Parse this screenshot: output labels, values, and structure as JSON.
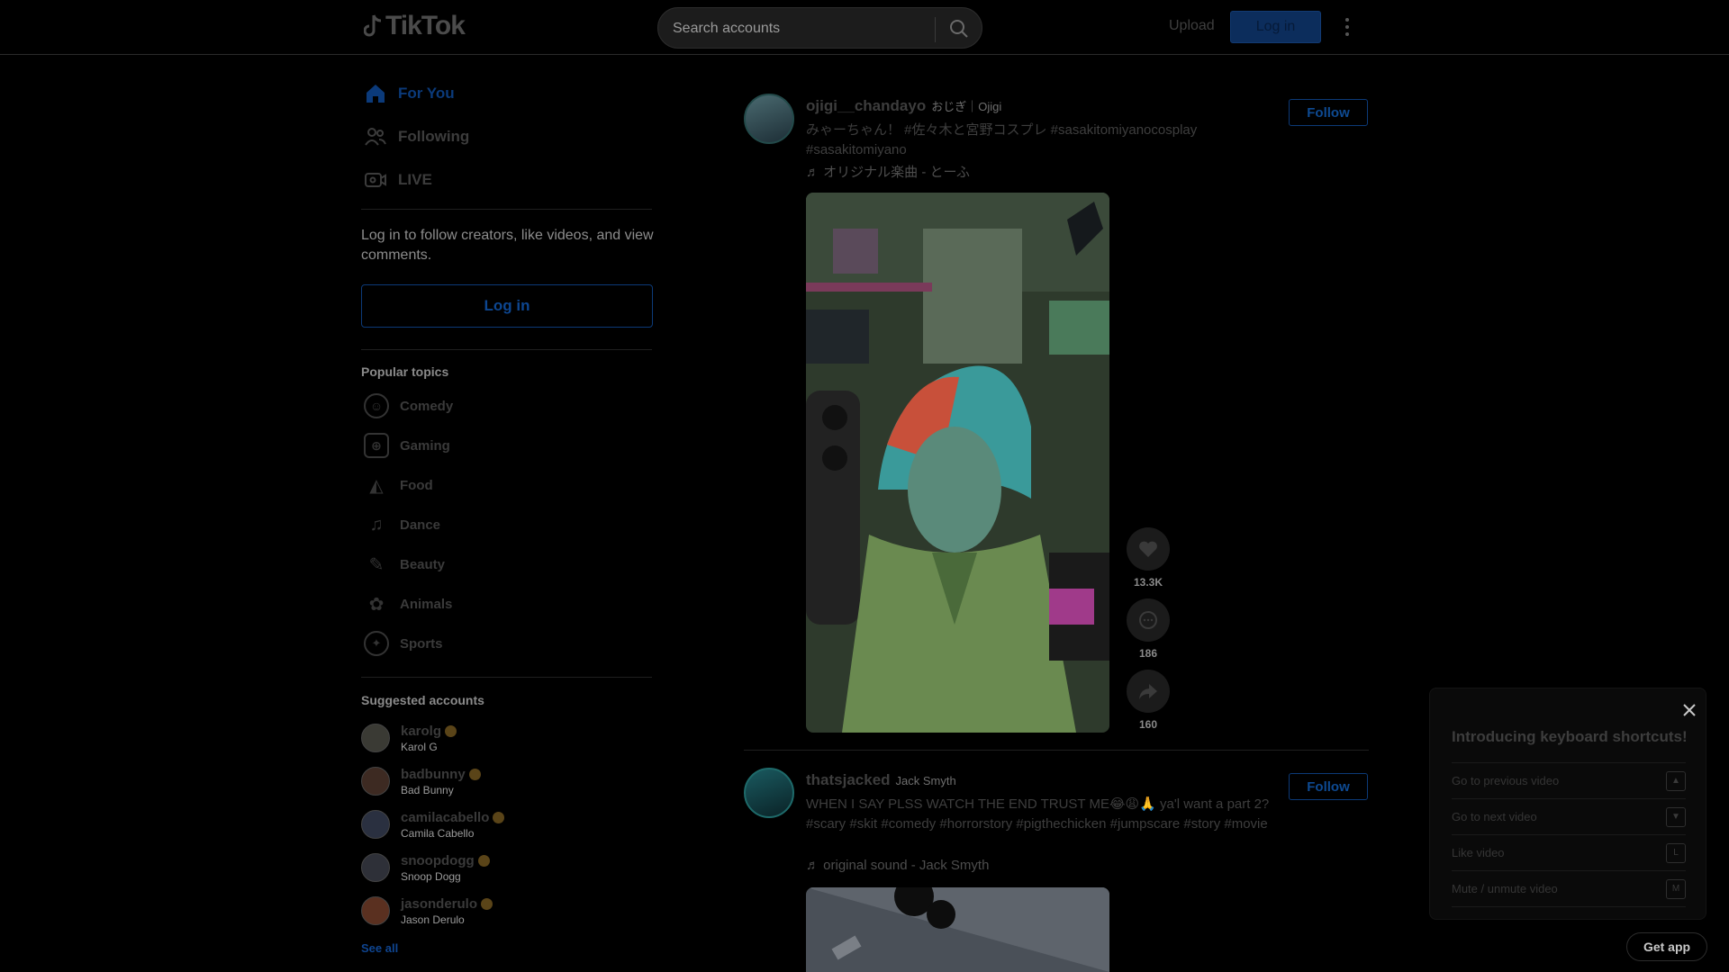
{
  "header": {
    "logo_text": "TikTok",
    "search_placeholder": "Search accounts",
    "upload_label": "Upload",
    "login_label": "Log in"
  },
  "sidebar": {
    "nav": [
      {
        "label": "For You",
        "icon": "home-icon",
        "active": true
      },
      {
        "label": "Following",
        "icon": "people-icon"
      },
      {
        "label": "LIVE",
        "icon": "live-icon"
      }
    ],
    "login_hint": "Log in to follow creators, like videos, and view comments.",
    "login_button": "Log in",
    "popular_title": "Popular topics",
    "topics": [
      {
        "label": "Comedy",
        "icon": "comedy-icon"
      },
      {
        "label": "Gaming",
        "icon": "gaming-icon"
      },
      {
        "label": "Food",
        "icon": "food-icon"
      },
      {
        "label": "Dance",
        "icon": "dance-icon"
      },
      {
        "label": "Beauty",
        "icon": "beauty-icon"
      },
      {
        "label": "Animals",
        "icon": "animals-icon"
      },
      {
        "label": "Sports",
        "icon": "sports-icon"
      }
    ],
    "suggested_title": "Suggested accounts",
    "accounts": [
      {
        "handle": "karolg",
        "name": "Karol G",
        "verified": true
      },
      {
        "handle": "badbunny",
        "name": "Bad Bunny",
        "verified": true
      },
      {
        "handle": "camilacabello",
        "name": "Camila Cabello",
        "verified": true
      },
      {
        "handle": "snoopdogg",
        "name": "Snoop Dogg",
        "verified": true
      },
      {
        "handle": "jasonderulo",
        "name": "Jason Derulo",
        "verified": true
      }
    ],
    "see_all": "See all"
  },
  "feed": [
    {
      "username": "ojigi__chandayo",
      "display_name": "おじぎ｜Ojigi",
      "caption": "みゃーちゃん！ #佐々木と宮野コスプレ #sasakitomiyanocosplay #sasakitomiyano",
      "music": "♬ オリジナル楽曲 - とーふ",
      "follow_label": "Follow",
      "likes": "13.3K",
      "comments": "186",
      "shares": "160"
    },
    {
      "username": "thatsjacked",
      "display_name": "Jack Smyth",
      "caption": "WHEN I SAY PLSS WATCH THE END TRUST ME😂😩🙏 ya'l want a part 2? #scary #skit #comedy #horrorstory #pigthechicken #jumpscare #story #movie",
      "music": "♬ original sound - Jack Smyth",
      "follow_label": "Follow"
    }
  ],
  "shortcuts": {
    "title": "Introducing keyboard shortcuts!",
    "items": [
      {
        "label": "Go to previous video",
        "key": "▲"
      },
      {
        "label": "Go to next video",
        "key": "▼"
      },
      {
        "label": "Like video",
        "key": "L"
      },
      {
        "label": "Mute / unmute video",
        "key": "M"
      }
    ]
  },
  "get_app": "Get app",
  "colors": {
    "background": "#000000",
    "accent_blue": "#0c3a78",
    "text_dim": "#3d3d3d"
  }
}
